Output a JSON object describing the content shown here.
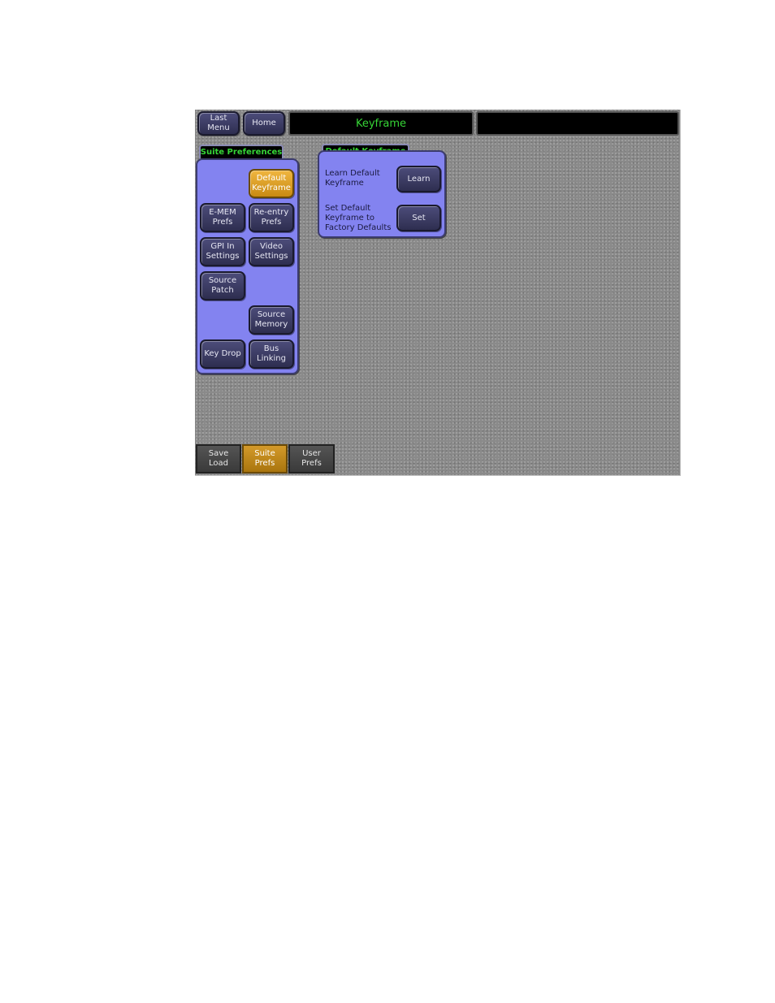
{
  "header": {
    "last_menu_label": "Last\nMenu",
    "home_label": "Home",
    "title": "Keyframe",
    "secondary_title": ""
  },
  "suite_preferences": {
    "tab_label": "Suite Preferences",
    "buttons": {
      "default_keyframe": "Default\nKeyframe",
      "emem_prefs": "E-MEM\nPrefs",
      "reentry_prefs": "Re-entry\nPrefs",
      "gpi_in_settings": "GPI In\nSettings",
      "video_settings": "Video\nSettings",
      "source_patch": "Source\nPatch",
      "source_memory": "Source\nMemory",
      "key_drop": "Key Drop",
      "bus_linking": "Bus\nLinking"
    },
    "selected": "default_keyframe"
  },
  "default_keyframe": {
    "tab_label": "Default Keyframe",
    "learn_text": "Learn Default\nKeyframe",
    "learn_button": "Learn",
    "set_text": "Set Default\nKeyframe to\nFactory Defaults",
    "set_button": "Set"
  },
  "bottom_tabs": [
    {
      "label": "Save\nLoad",
      "selected": false
    },
    {
      "label": "Suite\nPrefs",
      "selected": true
    },
    {
      "label": "User\nPrefs",
      "selected": false
    }
  ],
  "colors": {
    "panel": "#8383f0",
    "selected": "#e0a632",
    "title_text": "#36d536"
  }
}
